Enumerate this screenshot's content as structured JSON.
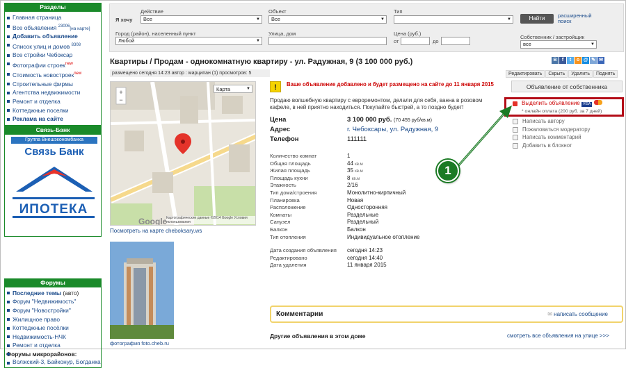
{
  "sidebar": {
    "sections_title": "Разделы",
    "items": [
      {
        "label": "Главная страница"
      },
      {
        "label": "Все объявления",
        "count": "23006",
        "extra": "[на карте]"
      },
      {
        "label": "Добавить объявление"
      },
      {
        "label": "Список улиц и домов",
        "count": "8308"
      },
      {
        "label": "Все стройки Чебоксар"
      },
      {
        "label": "Фотографии строек",
        "flag": "new"
      },
      {
        "label": "Стоимость новостроек",
        "flag": "new"
      },
      {
        "label": "Строительные фирмы"
      },
      {
        "label": "Агентства недвижимости"
      },
      {
        "label": "Ремонт и отделка"
      },
      {
        "label": "Коттеджные поселки"
      },
      {
        "label": "Реклама на сайте"
      }
    ],
    "bank_title": "Связь-Банк",
    "bank_strip": "Группа Внешэкономбанка",
    "bank_name": "Связь Банк",
    "bank_product": "ИПОТЕКА",
    "forums_title": "Форумы",
    "forum_items": [
      {
        "label": "Последние темы",
        "note": "(авто)"
      },
      {
        "label": "Форум \"Недвижимость\""
      },
      {
        "label": "Форум \"Новостройки\""
      },
      {
        "label": "Жилищное право"
      },
      {
        "label": "Коттеджные посёлки"
      },
      {
        "label": "Недвижимость-НЧК"
      },
      {
        "label": "Ремонт и отделка"
      }
    ],
    "micro_title": "Форумы микрорайонов:",
    "micro_text": "Волжский-3, Байконур, Богданка"
  },
  "search": {
    "want_label": "Я хочу",
    "action_label": "Действие",
    "action_value": "Все",
    "object_label": "Объект",
    "object_value": "Все",
    "type_label": "Тип",
    "type_value": "",
    "find_button": "Найти",
    "advanced_link": "расширенный поиск",
    "city_label": "Город (район), населенный пункт",
    "city_value": "Любой",
    "street_label": "Улица, дом",
    "price_label": "Цена (руб.)",
    "price_from": "от",
    "price_to": "до",
    "owner_label": "Собственник / застройщик",
    "owner_value": "все"
  },
  "listing": {
    "title": "Квартиры / Продам - однокомнатную квартиру - ул. Радужная, 9 (3 100 000 руб.)",
    "meta": "размещено сегодня 14:23   автор : марципан (1)   просмотров: 5",
    "toolbar": [
      "Редактировать",
      "Скрыть",
      "Удалить",
      "Поднять"
    ],
    "notice": "Ваше объявление добавлено и будет размещено на сайте до 11 января 2015",
    "notice_icon": "!",
    "description": "Продаю волшебную квартиру с евроремонтом, делали для себя, ванна в розовом кафеле, в ней приятно находиться. Покупайте быстрей, а то поздно будет!",
    "price_label": "Цена",
    "price_value": "3 100 000 руб.",
    "price_per_m": "(70 455 руб/кв.м)",
    "address_label": "Адрес",
    "address_value": "г. Чебоксары, ул. Радужная, 9",
    "phone_label": "Телефон",
    "phone_value": "111111",
    "properties": [
      {
        "k": "Количество комнат",
        "v": "1"
      },
      {
        "k": "Общая площадь",
        "v": "44",
        "unit": "кв.м"
      },
      {
        "k": "Жилая площадь",
        "v": "35",
        "unit": "кв.м"
      },
      {
        "k": "Площадь кухни",
        "v": "8",
        "unit": "кв.м"
      },
      {
        "k": "Этажность",
        "v": "2/16"
      },
      {
        "k": "Тип дома/строения",
        "v": "Монолитно-кирпичный"
      },
      {
        "k": "Планировка",
        "v": "Новая"
      },
      {
        "k": "Расположение",
        "v": "Односторонняя"
      },
      {
        "k": "Комнаты",
        "v": "Раздельные"
      },
      {
        "k": "Санузел",
        "v": "Раздельный"
      },
      {
        "k": "Балкон",
        "v": "Балкон"
      },
      {
        "k": "Тип отопления",
        "v": "Индивидуальное отопление"
      }
    ],
    "dates": [
      {
        "k": "Дата создания объявления",
        "v": "сегодня 14:23"
      },
      {
        "k": "Редактировано",
        "v": "сегодня 14:40"
      },
      {
        "k": "Дата удаления",
        "v": "11 января 2015"
      }
    ],
    "map_caption": "Посмотреть на карте cheboksary.ws",
    "map_type": "Карта",
    "map_copyright": "Картографические данные ©2014 Google   Условия использования",
    "photo_caption": "фотография foto.cheb.ru"
  },
  "side_actions": {
    "owner_button": "Объявление от собственника",
    "highlight_title": "Выделить объявление",
    "highlight_sub": "* онлайн оплата (200 руб. за 7 дней)",
    "items": [
      "Написать автору",
      "Пожаловаться модератору",
      "Написать комментарий",
      "Добавить в блокнот"
    ]
  },
  "comments": {
    "title": "Комментарии",
    "write_link": "написать сообщение"
  },
  "others": {
    "title": "Другие объявления в этом доме",
    "street_link": "смотреть все объявления на улице >>>"
  },
  "annotation": {
    "number": "1"
  },
  "colors": {
    "brand_green": "#1a8a2a",
    "link": "#1a4a8a",
    "highlight": "#b30c17",
    "accent_red": "#cc0000"
  }
}
